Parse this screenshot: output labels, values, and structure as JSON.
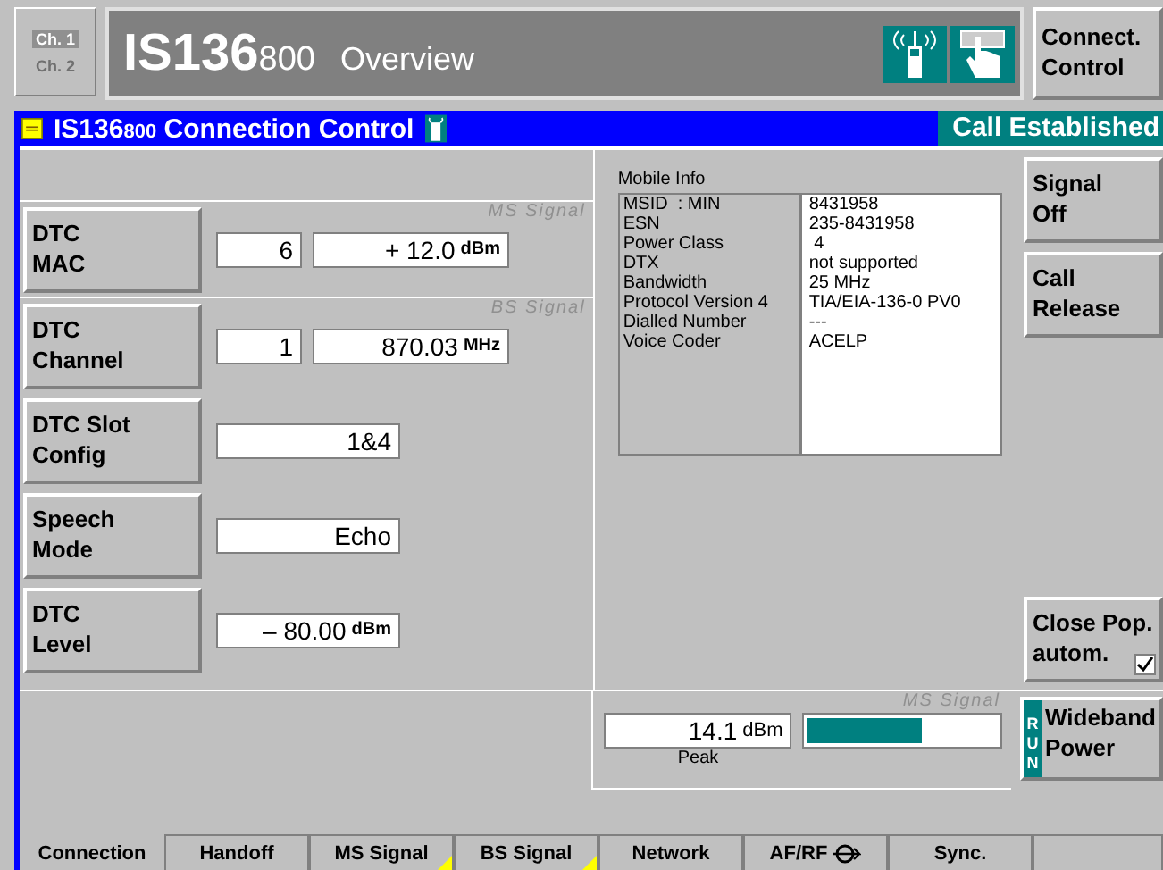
{
  "header": {
    "channels": [
      {
        "label": "Ch. 1",
        "selected": true
      },
      {
        "label": "Ch. 2",
        "selected": false
      }
    ],
    "title_main": "IS136",
    "title_band": "800",
    "title_text": "Overview",
    "side_button": "Connect.\nControl"
  },
  "bar": {
    "title_main": "IS136",
    "title_band": "800",
    "title_text": "Connection Control",
    "status": "Call Established"
  },
  "settings": [
    {
      "label": "DTC\nMAC",
      "group_label": "MS Signal",
      "fields": [
        {
          "value": "6"
        },
        {
          "value": "+ 12.0",
          "unit": "dBm"
        }
      ]
    },
    {
      "label": "DTC\nChannel",
      "group_label": "BS Signal",
      "fields": [
        {
          "value": "1"
        },
        {
          "value": "870.03",
          "unit": "MHz"
        }
      ]
    },
    {
      "label": "DTC Slot\nConfig",
      "fields": [
        {
          "value": "1&4"
        }
      ]
    },
    {
      "label": "Speech\nMode",
      "fields": [
        {
          "value": "Echo"
        }
      ]
    },
    {
      "label": "DTC\nLevel",
      "fields": [
        {
          "value": "– 80.00",
          "unit": "dBm"
        }
      ]
    }
  ],
  "mobile_info": {
    "title": "Mobile Info",
    "rows": [
      {
        "label": "MSID  : MIN",
        "value": "8431958"
      },
      {
        "label": "ESN",
        "value": "235-8431958"
      },
      {
        "label": "Power Class",
        "value": " 4"
      },
      {
        "label": "DTX",
        "value": "not supported"
      },
      {
        "label": "Bandwidth",
        "value": "25 MHz"
      },
      {
        "label": "Protocol Version 4",
        "value": "TIA/EIA-136-0 PV0"
      },
      {
        "label": "Dialled Number",
        "value": "---"
      },
      {
        "label": "Voice Coder",
        "value": "ACELP"
      }
    ]
  },
  "right_buttons": {
    "signal_off": "Signal\nOff",
    "call_release": "Call\nRelease",
    "close_popup": {
      "label": "Close Pop.\nautom.",
      "checked": true
    }
  },
  "measurement": {
    "group_label": "MS Signal",
    "value": "14.1",
    "unit": "dBm",
    "caption": "Peak",
    "level": 0.6,
    "button": "Wideband\nPower",
    "run": "RUN"
  },
  "tabs": [
    {
      "label": "Connection",
      "selected": true,
      "marker": false,
      "icon": false
    },
    {
      "label": "Handoff",
      "selected": false,
      "marker": false,
      "icon": false
    },
    {
      "label": "MS Signal",
      "selected": false,
      "marker": true,
      "icon": false
    },
    {
      "label": "BS Signal",
      "selected": false,
      "marker": true,
      "icon": false
    },
    {
      "label": "Network",
      "selected": false,
      "marker": false,
      "icon": false
    },
    {
      "label": "AF/RF",
      "selected": false,
      "marker": false,
      "icon": true
    },
    {
      "label": "Sync.",
      "selected": false,
      "marker": false,
      "icon": false
    }
  ]
}
